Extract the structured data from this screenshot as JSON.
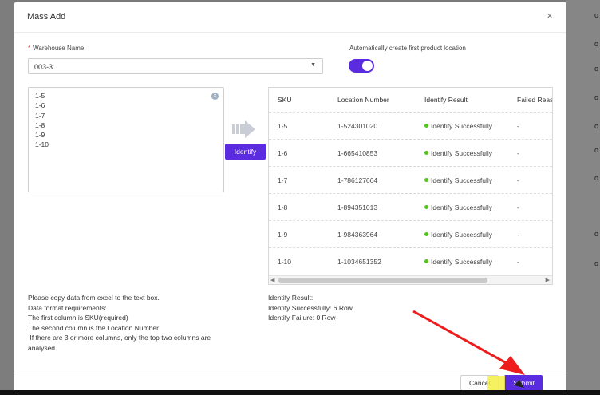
{
  "modal": {
    "title": "Mass Add",
    "close_glyph": "×"
  },
  "warehouse": {
    "label": "Warehouse Name",
    "required_mark": "*",
    "value": "003-3"
  },
  "auto_location": {
    "label": "Automatically create first product location",
    "enabled": true
  },
  "input_box": {
    "lines": [
      "1-5",
      "1-6",
      "1-7",
      "1-8",
      "1-9",
      "1-10"
    ]
  },
  "identify_button": "Identify",
  "table": {
    "headers": [
      "SKU",
      "Location Number",
      "Identify Result",
      "Failed Reas"
    ],
    "rows": [
      {
        "sku": "1-5",
        "location": "1-524301020",
        "result": "Identify Successfully",
        "reason": "-"
      },
      {
        "sku": "1-6",
        "location": "1-665410853",
        "result": "Identify Successfully",
        "reason": "-"
      },
      {
        "sku": "1-7",
        "location": "1-786127664",
        "result": "Identify Successfully",
        "reason": "-"
      },
      {
        "sku": "1-8",
        "location": "1-894351013",
        "result": "Identify Successfully",
        "reason": "-"
      },
      {
        "sku": "1-9",
        "location": "1-984363964",
        "result": "Identify Successfully",
        "reason": "-"
      },
      {
        "sku": "1-10",
        "location": "1-1034651352",
        "result": "Identify Successfully",
        "reason": "-"
      }
    ],
    "success_color": "#52c41a"
  },
  "instructions": [
    "Please copy data from excel to the text box.",
    "Data format requirements:",
    "The first column is SKU(required)",
    "The second column is the Location Number",
    " If there are 3 or more columns, only the top two columns are analysed."
  ],
  "identify_summary": {
    "title": "Identify Result:",
    "success": "Identify Successfully: 6 Row",
    "failure": "Identify Failure: 0 Row"
  },
  "footer": {
    "cancel": "Cancel",
    "submit": "Submit"
  },
  "accent_color": "#5b2be0",
  "background_edge_chars": [
    "o",
    "o",
    "o",
    "o",
    "o",
    "o",
    "o",
    "o",
    "o"
  ]
}
